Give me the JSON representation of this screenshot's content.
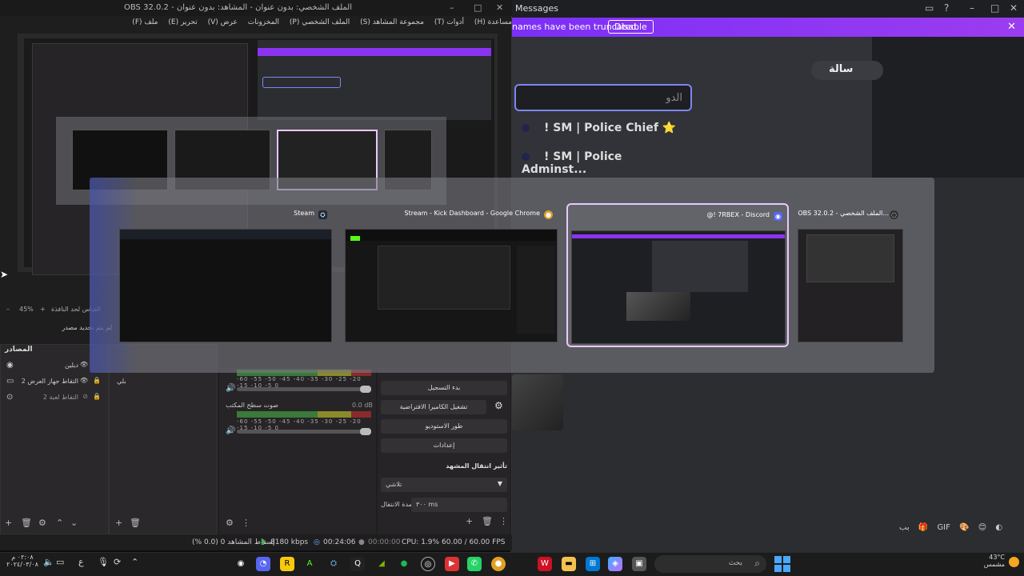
{
  "discord": {
    "title": "Messages",
    "banner_text": "names have been truncated.",
    "banner_button": "Disable",
    "search_placeholder": "الدو",
    "items": [
      "! SM | Police Chief ⭐",
      "! SM | Police Adminst..."
    ],
    "pill_label": "سالة",
    "bottom_icons": [
      "بب",
      "🎁",
      "GIF",
      "🎨",
      "😊",
      "◐"
    ]
  },
  "obs": {
    "title": "OBS 32.0.2 - الملف الشخصي: بدون عنوان - المشاهد: بدون عنوان",
    "menu": [
      "ملف (F)",
      "تحرير (E)",
      "عرض (V)",
      "المخزونات",
      "الملف الشخصي (P)",
      "مجموعة المشاهد (S)",
      "أدوات (T)",
      "مساعدة (H)"
    ],
    "zoom": "45%",
    "zoom_label": "القياس لحد النافذة",
    "sources_message": "لم يتم تحديد مصدر",
    "sources_header": "المصادر",
    "sources": [
      {
        "name": "ديلين"
      },
      {
        "name": "التقاط جهاز العرض 2"
      },
      {
        "name": "التقاط لعبة 2"
      }
    ],
    "mixer_label_1": "بلي",
    "mixer_label_2": "صوت سطح المكتب",
    "mixer_db": "0.0 dB",
    "meter_scale": "-60 -55 -50 -45 -40 -35 -30 -25 -20 -15 -10 -5 0",
    "controls": [
      "بدء التسجيل",
      "تشغيل الكاميرا الافتراضية",
      "طور الاستوديو",
      "إعدادات"
    ],
    "transition_header": "تأثير انتقال المشهد",
    "transition_value": "تلاشي",
    "duration_label": "مدة الانتقال",
    "duration_value": "٣٠٠ ms",
    "status": {
      "dropped": "إسقاط المشاهد 0 (0.0 %)",
      "bitrate": "8180 kbps",
      "stream_time": "00:24:06",
      "rec_time": "00:00:00",
      "cpu": "CPU: 1.9%",
      "fps": "60.00 / 60.00 FPS"
    }
  },
  "switcher": {
    "tiles": [
      {
        "label": "Steam",
        "icon": "steam-icon",
        "selected": false
      },
      {
        "label": "Stream - Kick Dashboard - Google Chrome",
        "icon": "chrome-icon",
        "selected": false
      },
      {
        "label": "@! 7RBEX - Discord",
        "icon": "discord-icon",
        "selected": true
      },
      {
        "label": "OBS 32.0.2 - الملف الشخصي...",
        "icon": "obs-icon",
        "selected": false
      }
    ]
  },
  "taskbar": {
    "search_placeholder": "بحث",
    "weather_temp": "43°C",
    "weather_desc": "مشمس",
    "time": "٠٢:٠٨ م",
    "date": "٢٠٢٤/٠٣/٠٨"
  },
  "colors": {
    "discord_accent": "#7e86f5",
    "banner": "#8a34f2",
    "switch_selected_border": "#e9c8ff"
  }
}
